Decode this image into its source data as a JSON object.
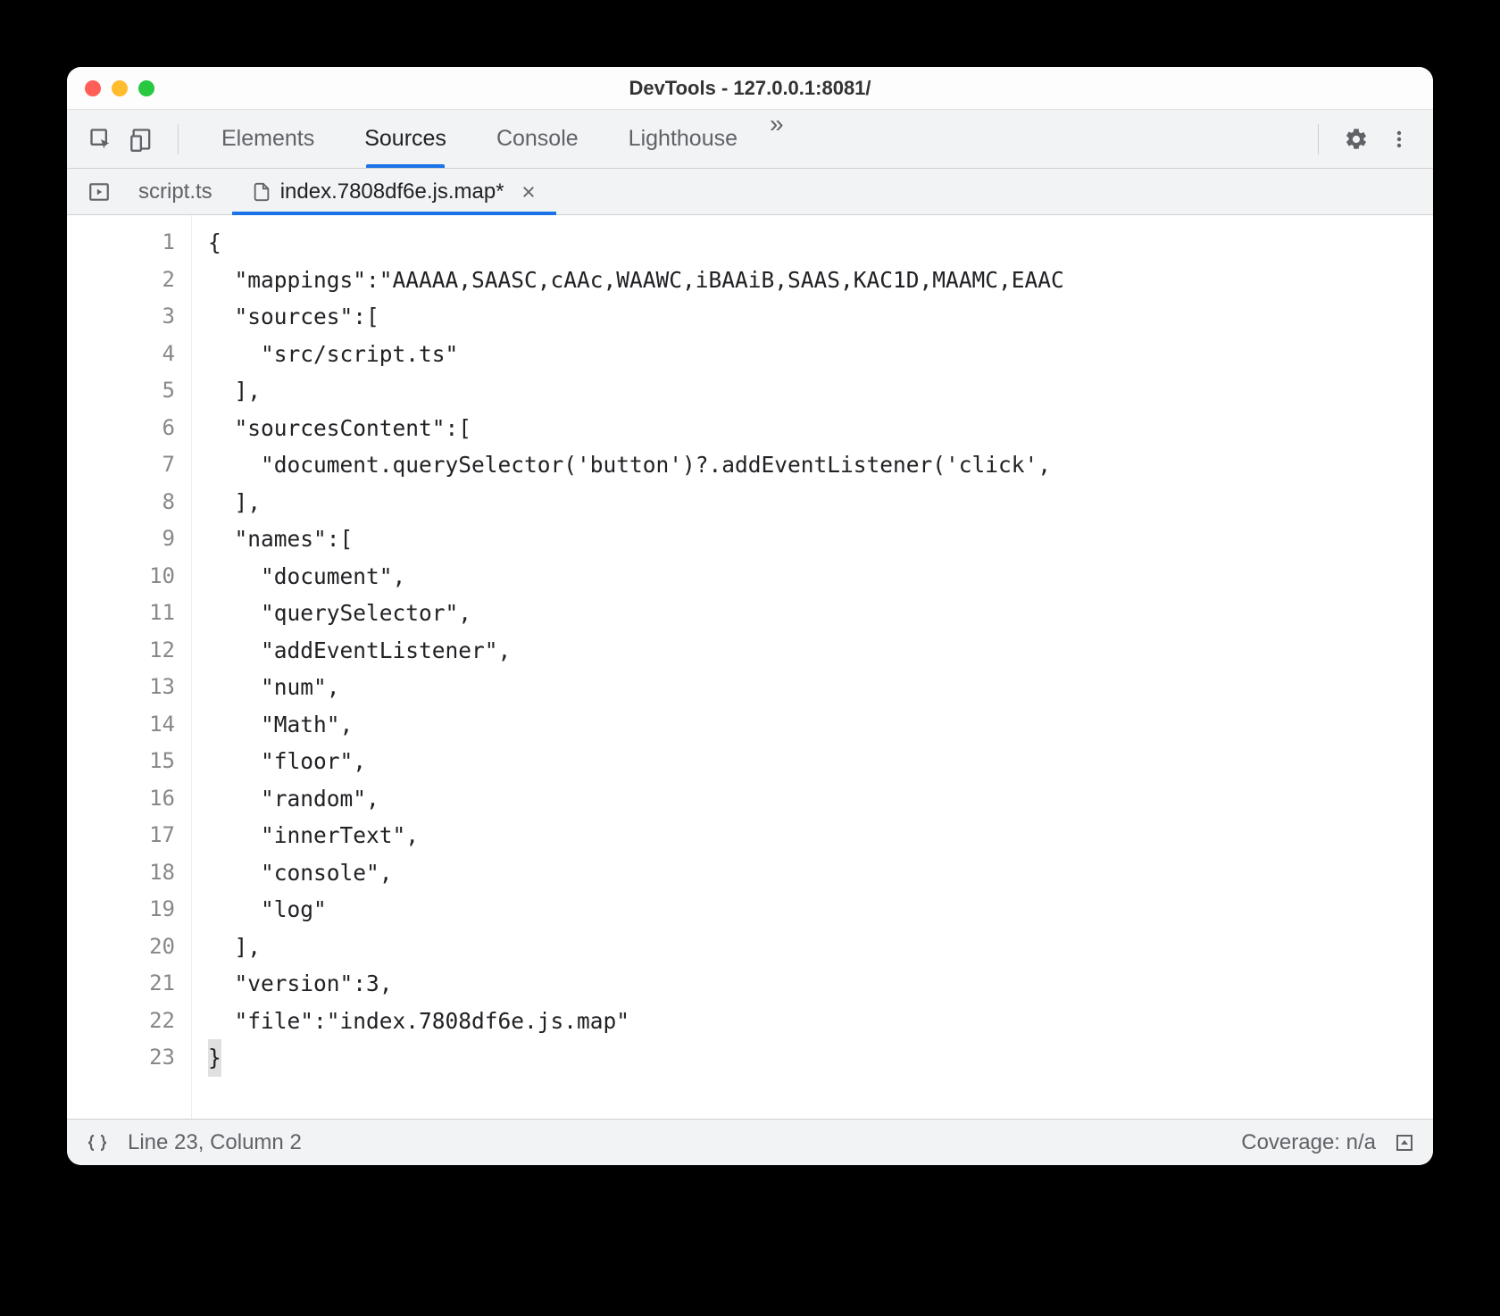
{
  "window": {
    "title": "DevTools - 127.0.0.1:8081/"
  },
  "toolbar": {
    "tabs": [
      {
        "label": "Elements",
        "active": false
      },
      {
        "label": "Sources",
        "active": true
      },
      {
        "label": "Console",
        "active": false
      },
      {
        "label": "Lighthouse",
        "active": false
      }
    ],
    "more_glyph": "»"
  },
  "filetabs": [
    {
      "label": "script.ts",
      "active": false,
      "has_icon": false,
      "has_close": false
    },
    {
      "label": "index.7808df6e.js.map*",
      "active": true,
      "has_icon": true,
      "has_close": true
    }
  ],
  "editor": {
    "line_count": 23,
    "lines": [
      "{",
      "  \"mappings\":\"AAAAA,SAASC,cAAc,WAAWC,iBAAiB,SAAS,KAC1D,MAAMC,EAAC",
      "  \"sources\":[",
      "    \"src/script.ts\"",
      "  ],",
      "  \"sourcesContent\":[",
      "    \"document.querySelector('button')?.addEventListener('click',",
      "  ],",
      "  \"names\":[",
      "    \"document\",",
      "    \"querySelector\",",
      "    \"addEventListener\",",
      "    \"num\",",
      "    \"Math\",",
      "    \"floor\",",
      "    \"random\",",
      "    \"innerText\",",
      "    \"console\",",
      "    \"log\"",
      "  ],",
      "  \"version\":3,",
      "  \"file\":\"index.7808df6e.js.map\"",
      "}"
    ]
  },
  "statusbar": {
    "position": "Line 23, Column 2",
    "coverage": "Coverage: n/a"
  }
}
